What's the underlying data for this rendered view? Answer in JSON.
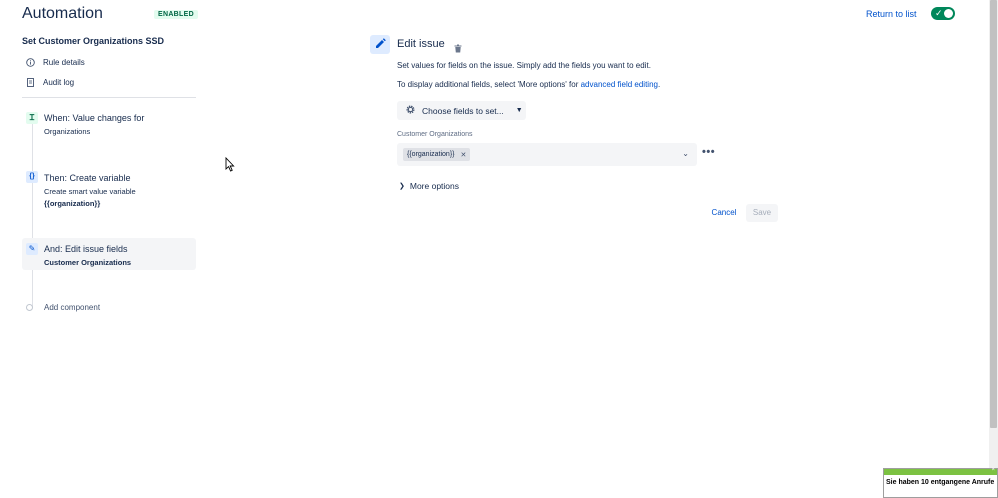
{
  "header": {
    "title": "Automation",
    "status_badge": "ENABLED",
    "return_link": "Return to list",
    "toggle_icon": "check-icon"
  },
  "sidebar": {
    "rule_name": "Set Customer Organizations SSD",
    "links": [
      {
        "label": "Rule details",
        "icon": "info-icon"
      },
      {
        "label": "Audit log",
        "icon": "document-icon"
      }
    ],
    "steps": [
      {
        "title": "When: Value changes for",
        "sub": "Organizations",
        "bold": "",
        "icon": "trigger-icon",
        "icon_glyph": "Ɪ"
      },
      {
        "title": "Then: Create variable",
        "sub": "Create smart value variable",
        "bold": "{{organization}}",
        "icon": "braces-icon",
        "icon_glyph": "{}"
      },
      {
        "title": "And: Edit issue fields",
        "sub": "",
        "bold": "Customer Organizations",
        "icon": "pencil-icon",
        "icon_glyph": "✎"
      }
    ],
    "add_component": "Add component"
  },
  "editor": {
    "title": "Edit issue",
    "desc1": "Set values for fields on the issue. Simply add the fields you want to edit.",
    "desc2_prefix": "To display additional fields, select 'More options' for ",
    "desc2_link": "advanced field editing",
    "desc2_suffix": ".",
    "choose_fields": "Choose fields to set...",
    "field_label": "Customer Organizations",
    "field_tag": "{{organization}}",
    "more_options": "More options",
    "cancel": "Cancel",
    "save": "Save"
  },
  "notification": {
    "text": "Sie haben 10 entgangene Anrufe",
    "close": "×"
  },
  "colors": {
    "accent": "#0052cc",
    "enabled": "#00875a",
    "notification_bar": "#7cc242"
  }
}
